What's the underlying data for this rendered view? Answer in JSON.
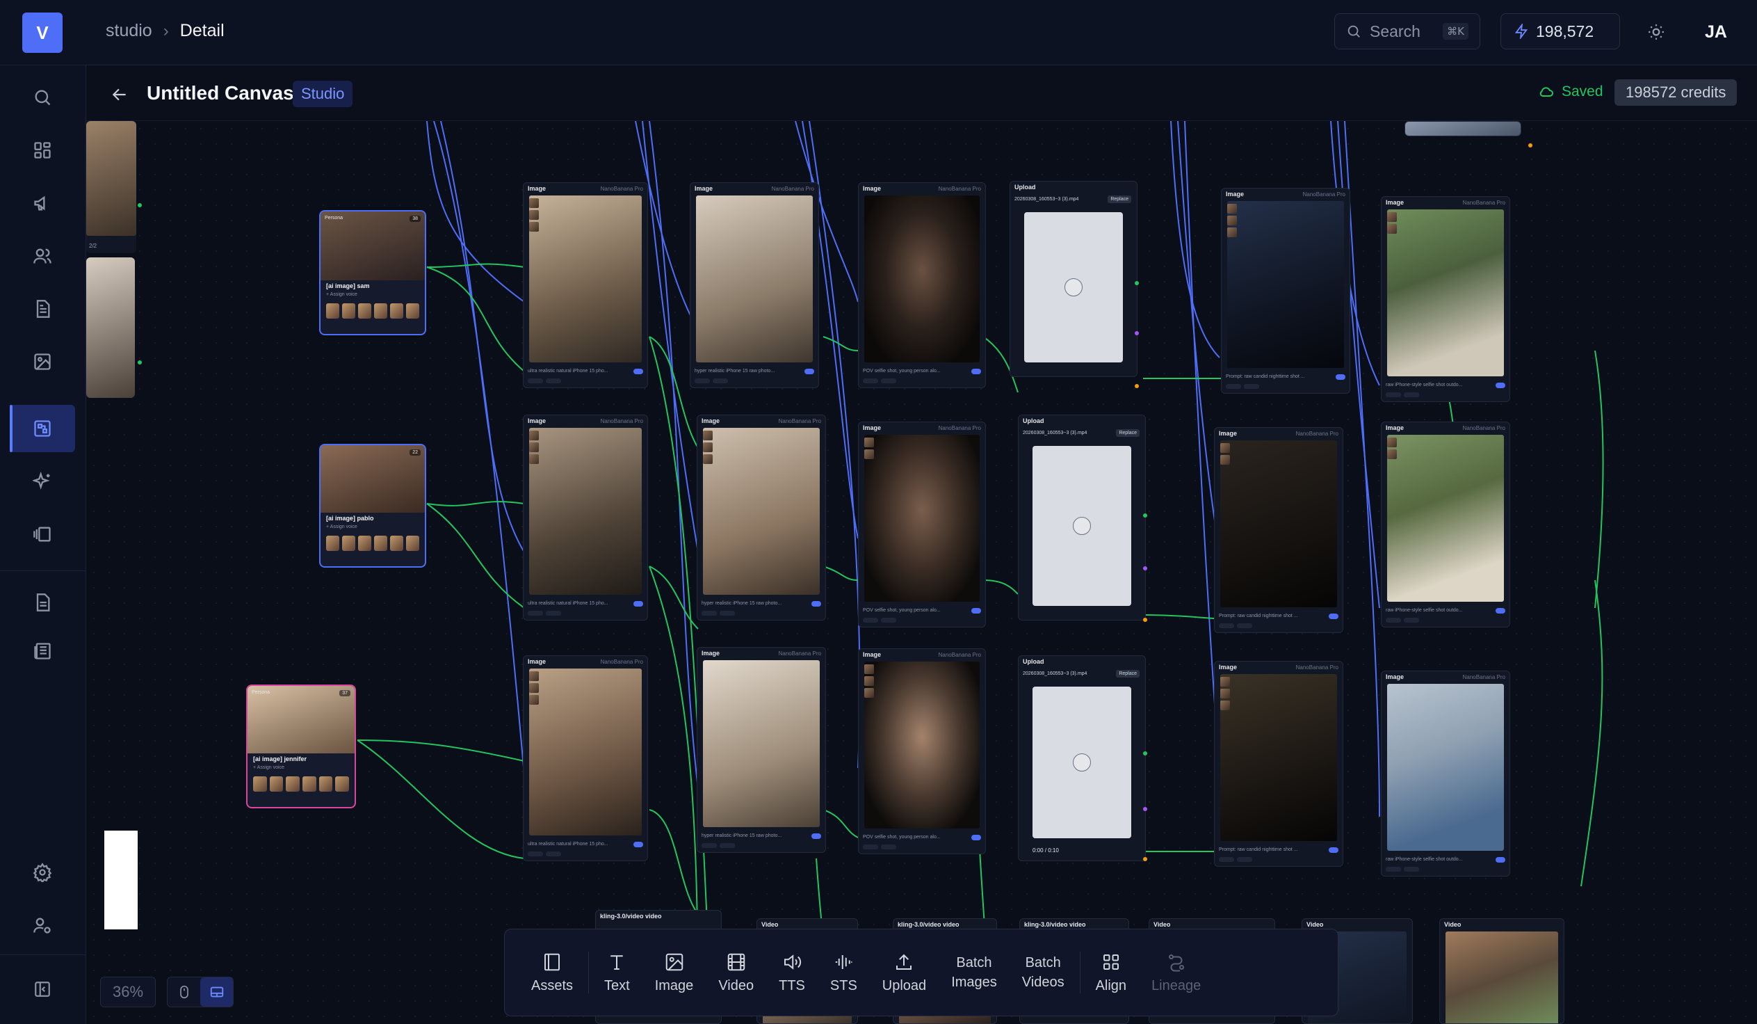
{
  "app": {
    "logo": "V"
  },
  "breadcrumb": {
    "root": "studio",
    "current": "Detail"
  },
  "search": {
    "placeholder": "Search",
    "shortcut": "⌘K"
  },
  "credits": {
    "value": "198,572"
  },
  "user": {
    "initials": "JA"
  },
  "sidebar": {
    "items": [
      {
        "icon": "search-icon"
      },
      {
        "icon": "dashboard-icon"
      },
      {
        "icon": "megaphone-icon"
      },
      {
        "icon": "users-icon"
      },
      {
        "icon": "document-icon"
      },
      {
        "icon": "image-icon"
      },
      {
        "icon": "canvas-icon",
        "active": true
      },
      {
        "icon": "sparkles-icon"
      },
      {
        "icon": "carousel-icon"
      },
      {
        "icon": "file-icon"
      },
      {
        "icon": "newspaper-icon"
      },
      {
        "icon": "settings-icon"
      },
      {
        "icon": "user-settings-icon"
      },
      {
        "icon": "collapse-sidebar-icon"
      }
    ]
  },
  "canvas_header": {
    "title": "Untitled Canvas",
    "badge": "Studio",
    "save_status": "Saved",
    "credits_badge": "198572 credits"
  },
  "nodes": {
    "image_label": "Image",
    "model": "NanoBanana Pro",
    "upload_label": "Upload",
    "upload_file": "20260308_160553~3 (3).mp4",
    "replace_label": "Replace",
    "video_label": "Video",
    "kling_label": "kling-3.0/video video",
    "video_time": "0:00 / 0:10",
    "prompts": {
      "col1": "ultra realistic natural iPhone 15 pho...",
      "col2": "hyper realistic iPhone 15 raw photo...",
      "col3": "POV selfie shot, young person alo...",
      "col5": "Prompt: raw candid nighttime shot ...",
      "col6": "raw iPhone-style selfie shot outdo..."
    }
  },
  "personas": [
    {
      "name": "[ai image] sam",
      "sub": "+ Assign voice",
      "count": "38"
    },
    {
      "name": "[ai image] pablo",
      "sub": "+ Assign voice",
      "count": "22"
    },
    {
      "name": "[ai image] jennifer",
      "sub": "+ Assign voice",
      "count": "37"
    }
  ],
  "left_node": {
    "counter": "2/2"
  },
  "toolbar": {
    "items": [
      {
        "label": "Assets",
        "icon": "assets-icon"
      },
      {
        "label": "Text",
        "icon": "text-icon"
      },
      {
        "label": "Image",
        "icon": "image-icon"
      },
      {
        "label": "Video",
        "icon": "video-icon"
      },
      {
        "label": "TTS",
        "icon": "speaker-icon"
      },
      {
        "label": "STS",
        "icon": "waveform-icon"
      },
      {
        "label": "Upload",
        "icon": "upload-icon"
      },
      {
        "label": "Batch\nImages",
        "icon": ""
      },
      {
        "label": "Batch\nVideos",
        "icon": ""
      },
      {
        "label": "Align",
        "icon": "align-icon"
      },
      {
        "label": "Lineage",
        "icon": "lineage-icon"
      }
    ]
  },
  "zoom": {
    "level": "36%"
  },
  "colors": {
    "accent": "#4f6ef7",
    "edge_green": "#22c55e",
    "edge_blue": "#4f6ef7",
    "saved": "#22c55e"
  }
}
